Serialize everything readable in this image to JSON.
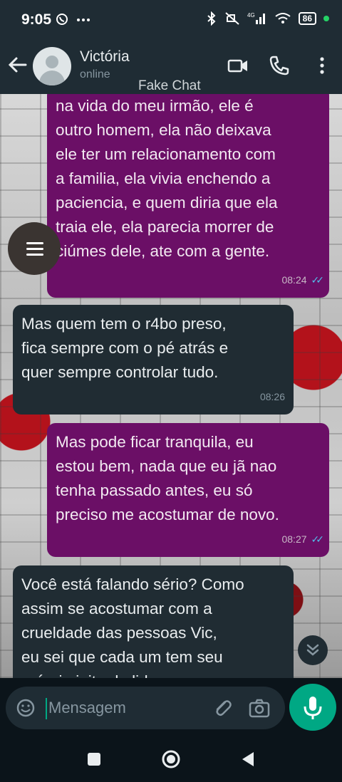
{
  "status_bar": {
    "time": "9:05",
    "battery": "86",
    "notif_icons": [
      "whatsapp-icon",
      "more-dots-icon"
    ],
    "right_icons": [
      "bluetooth-icon",
      "mute-icon",
      "signal-4g-icon",
      "wifi-icon",
      "battery-icon"
    ]
  },
  "header": {
    "contact_name": "Victória",
    "status": "online",
    "watermark": "Fake Chat"
  },
  "messages": [
    {
      "direction": "outgoing",
      "lines": [
        "na vida do meu irmão, ele é",
        "outro homem, ela não deixava",
        "ele ter um relacionamento com",
        "a familia, ela vivia enchendo a",
        "paciencia, e quem diria que ela",
        "traia ele, ela parecia morrer de",
        "ciúmes dele, ate com a gente."
      ],
      "time": "08:24"
    },
    {
      "direction": "incoming",
      "lines": [
        "Mas quem tem o r4bo preso,",
        "fica sempre com o pé atrás e",
        "quer sempre controlar tudo."
      ],
      "time": "08:26"
    },
    {
      "direction": "outgoing",
      "lines": [
        "Mas pode ficar tranquila, eu",
        "estou bem, nada que eu jã nao",
        "tenha passado antes, eu só",
        "preciso me acostumar de novo."
      ],
      "time": "08:27"
    },
    {
      "direction": "incoming",
      "lines": [
        "Você está falando sério? Como",
        "assim se acostumar com a",
        "crueldade das pessoas Vic,",
        "eu sei que cada um tem seu",
        "próprio jeito de lidar com"
      ],
      "time": ""
    }
  ],
  "composer": {
    "placeholder": "Mensagem"
  },
  "colors": {
    "outgoing_bubble": "#6b0f66",
    "incoming_bubble": "#202c33",
    "accent": "#00a884",
    "read_ticks": "#53bdeb"
  }
}
